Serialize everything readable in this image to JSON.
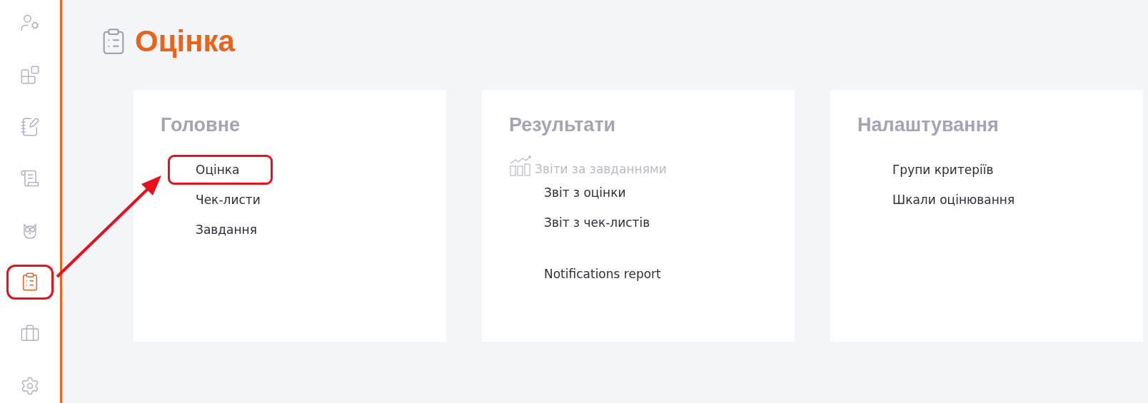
{
  "sidebar": {
    "items": [
      {
        "selected": false,
        "highlighted": false
      },
      {
        "selected": false,
        "highlighted": false
      },
      {
        "selected": false,
        "highlighted": false
      },
      {
        "selected": false,
        "highlighted": false
      },
      {
        "selected": false,
        "highlighted": false
      },
      {
        "selected": true,
        "highlighted": true
      },
      {
        "selected": false,
        "highlighted": false
      },
      {
        "selected": false,
        "highlighted": false
      }
    ]
  },
  "page": {
    "title": "Оцінка"
  },
  "cards": [
    {
      "title": "Головне",
      "items": [
        {
          "kind": "link",
          "label": "Оцінка",
          "highlighted": true
        },
        {
          "kind": "link",
          "label": "Чек-листи",
          "highlighted": false
        },
        {
          "kind": "link",
          "label": "Завдання",
          "highlighted": false
        }
      ]
    },
    {
      "title": "Результати",
      "items": [
        {
          "kind": "section",
          "label": "Звіти за завданнями",
          "highlighted": false
        },
        {
          "kind": "link",
          "label": "Звіт з оцінки",
          "highlighted": false
        },
        {
          "kind": "link",
          "label": "Звіт з чек-листів",
          "highlighted": false
        },
        {
          "kind": "spacer"
        },
        {
          "kind": "link",
          "label": "Notifications report",
          "highlighted": false
        }
      ]
    },
    {
      "title": "Налаштування",
      "items": [
        {
          "kind": "link",
          "label": "Групи критеріїв",
          "highlighted": false
        },
        {
          "kind": "link",
          "label": "Шкали оцінювання",
          "highlighted": false
        }
      ]
    }
  ]
}
